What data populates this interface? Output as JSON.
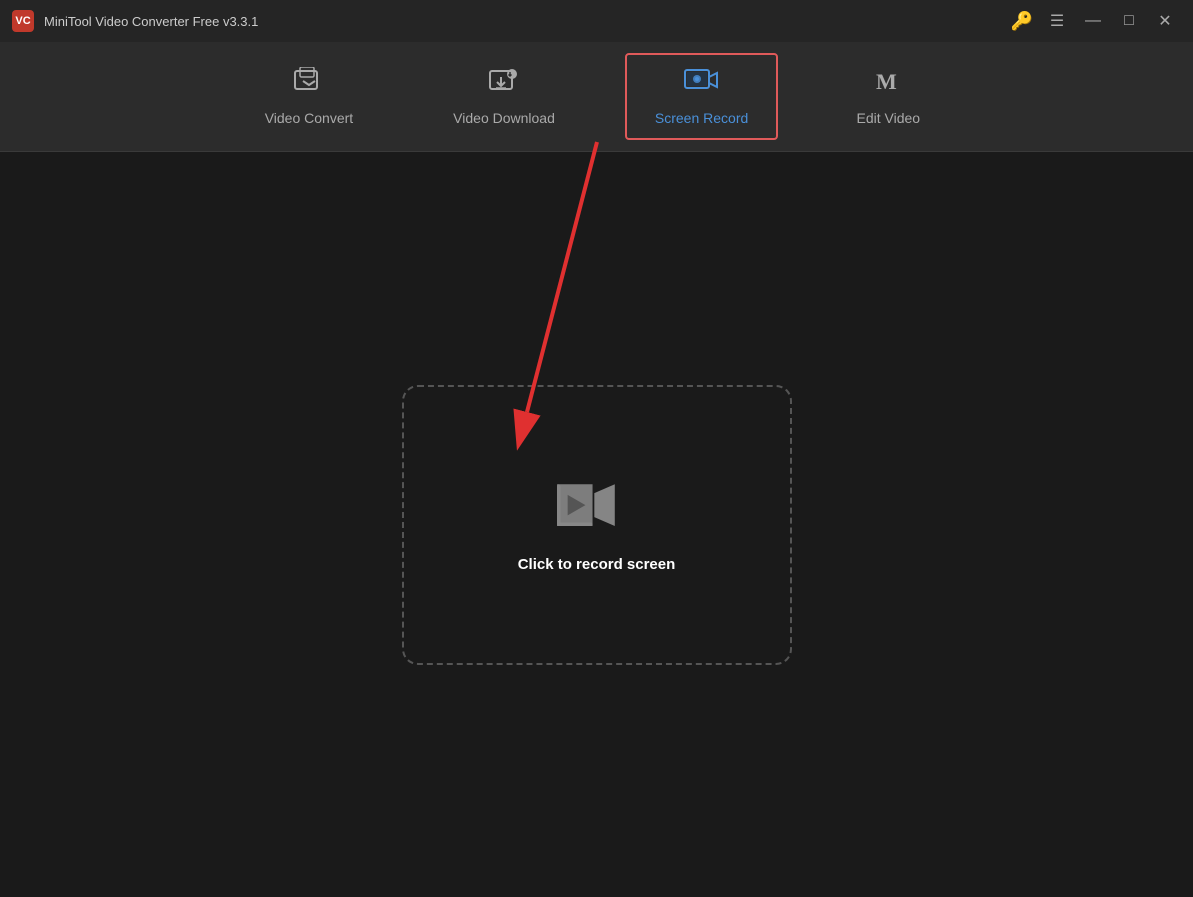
{
  "app": {
    "title": "MiniTool Video Converter Free v3.3.1",
    "logo_text": "VC"
  },
  "titlebar": {
    "key_icon": "🔑",
    "menu_icon": "☰",
    "minimize_icon": "—",
    "maximize_icon": "□",
    "close_icon": "✕"
  },
  "nav": {
    "tabs": [
      {
        "id": "video-convert",
        "label": "Video Convert",
        "icon": "⊞",
        "active": false
      },
      {
        "id": "video-download",
        "label": "Video Download",
        "icon": "⊡",
        "active": false
      },
      {
        "id": "screen-record",
        "label": "Screen Record",
        "icon": "🎥",
        "active": true
      },
      {
        "id": "edit-video",
        "label": "Edit Video",
        "icon": "M",
        "active": false
      }
    ]
  },
  "main": {
    "record_label": "Click to record screen"
  }
}
